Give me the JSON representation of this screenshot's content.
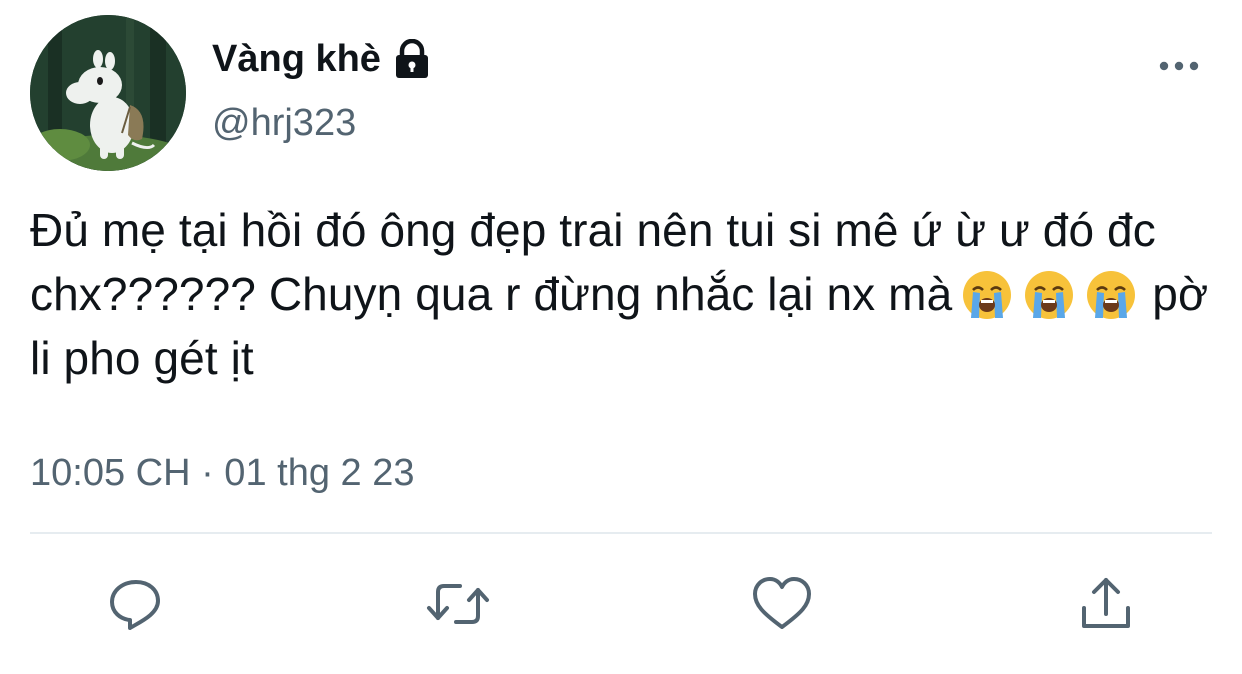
{
  "user": {
    "display_name": "Vàng khè",
    "handle": "@hrj323",
    "protected_icon": "lock-icon",
    "avatar": "moomin-avatar"
  },
  "menu_icon": "more-dots-icon",
  "tweet": {
    "text_part1": "Đủ mẹ tại hồi đó ông đẹp trai nên tui si mê ứ ừ ư đó đc chx?????? Chuyṇ qua r đừng nhắc lại nx mà",
    "emoji": [
      "😭",
      "😭",
      "😭"
    ],
    "text_part2": "pờ li pho gét ịt",
    "timestamp": "10:05 CH · 01 thg 2 23"
  },
  "actions": [
    {
      "icon": "reply-icon"
    },
    {
      "icon": "retweet-icon"
    },
    {
      "icon": "like-heart-icon"
    },
    {
      "icon": "share-icon"
    }
  ],
  "colors": {
    "text": "#0f1419",
    "secondary": "#536471",
    "divider": "#e6ecf0",
    "emoji_face": "#f7c23a",
    "tears": "#5aa7e8"
  }
}
